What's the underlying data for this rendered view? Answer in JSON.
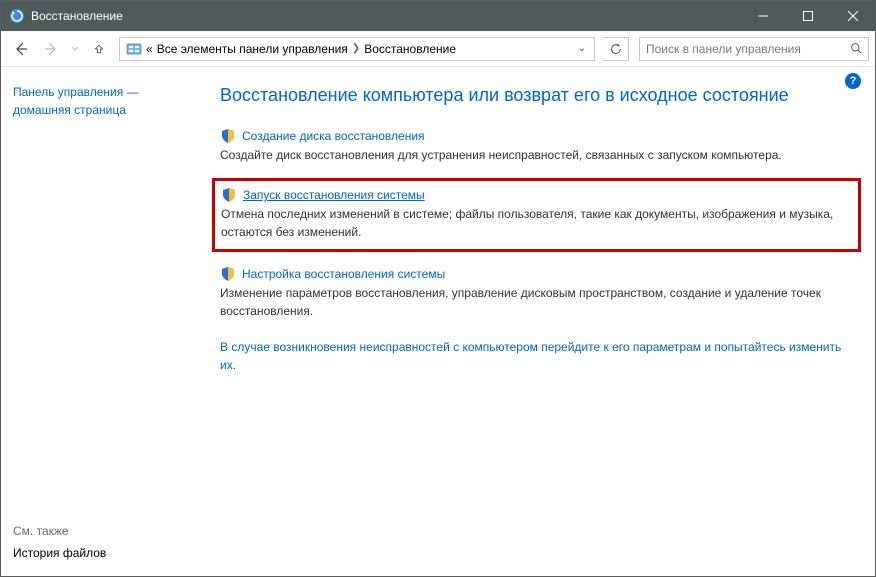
{
  "titlebar": {
    "title": "Восстановление"
  },
  "nav": {
    "breadcrumb": {
      "prefix": "«",
      "parent": "Все элементы панели управления",
      "current": "Восстановление"
    },
    "search_placeholder": "Поиск в панели управления"
  },
  "sidebar": {
    "homepage_line1": "Панель управления —",
    "homepage_line2": "домашняя страница",
    "see_also": "См. также",
    "file_history": "История файлов"
  },
  "content": {
    "heading": "Восстановление компьютера или возврат его в исходное состояние",
    "section1": {
      "link": "Создание диска восстановления",
      "desc": "Создайте диск восстановления для устранения неисправностей, связанных с запуском компьютера."
    },
    "section2": {
      "link": "Запуск восстановления системы",
      "desc": "Отмена последних изменений в системе; файлы пользователя, такие как документы, изображения и музыка, остаются без изменений."
    },
    "section3": {
      "link": "Настройка восстановления системы",
      "desc": "Изменение параметров восстановления, управление дисковым пространством, создание и удаление точек восстановления."
    },
    "extra_link": "В случае возникновения неисправностей с компьютером перейдите к его параметрам и попытайтесь изменить их."
  }
}
